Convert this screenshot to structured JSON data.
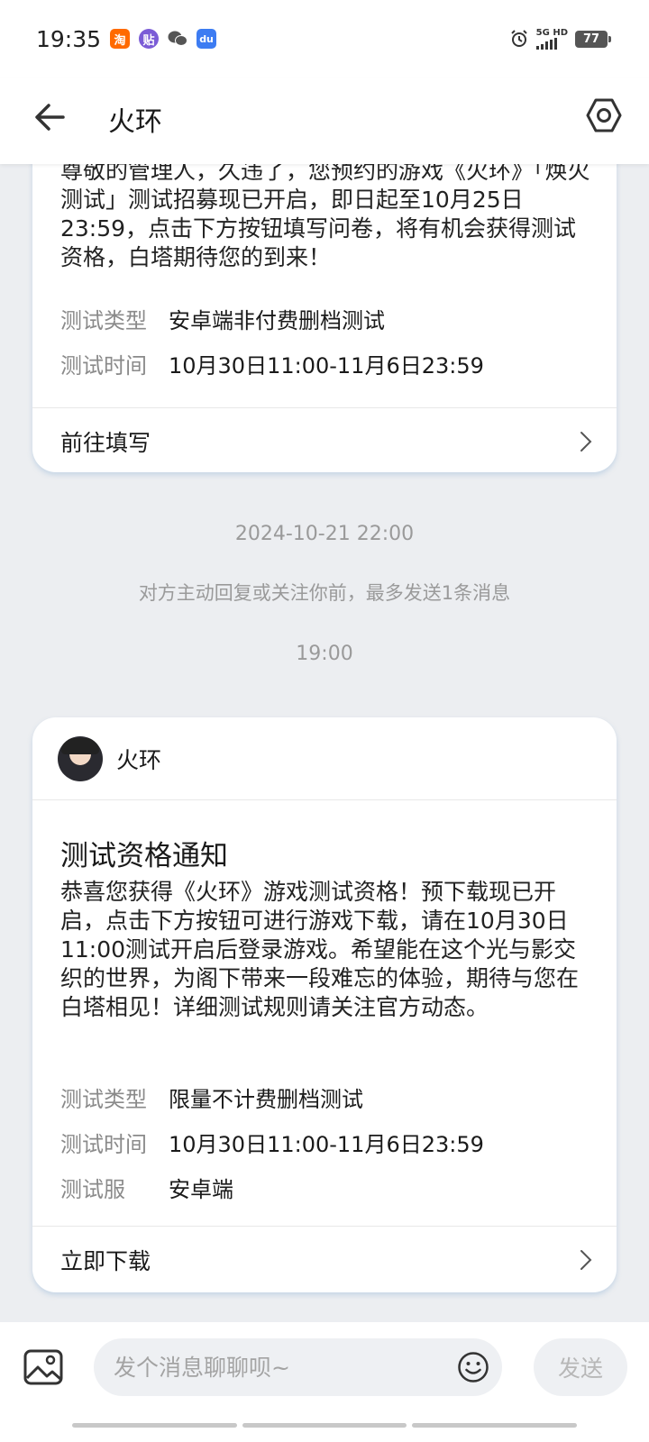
{
  "status_bar": {
    "time": "19:35",
    "notifications": [
      {
        "icon": "taobao-icon",
        "glyph": "淘",
        "color": "#ff6a00"
      },
      {
        "icon": "tieba-icon",
        "glyph": "贴",
        "color": "#7b5cd6"
      },
      {
        "icon": "wechat-icon",
        "glyph": "",
        "color": "#555555"
      },
      {
        "icon": "baidu-icon",
        "glyph": "du",
        "color": "#3d7cf2"
      }
    ],
    "network": "5G HD",
    "battery": "77"
  },
  "header": {
    "title": "火环"
  },
  "messages": [
    {
      "body": "尊敬的管理人，久违了，您预约的游戏《火环》「焕火测试」测试招募现已开启，即日起至10月25日23:59，点击下方按钮填写问卷，将有机会获得测试资格，白塔期待您的到来！",
      "fields": [
        {
          "label": "测试类型",
          "value": "安卓端非付费删档测试"
        },
        {
          "label": "测试时间",
          "value": "10月30日11:00-11月6日23:59"
        }
      ],
      "action": "前往填写"
    },
    {
      "sender": "火环",
      "title": "测试资格通知",
      "body": "恭喜您获得《火环》游戏测试资格！预下载现已开启，点击下方按钮可进行游戏下载，请在10月30日11:00测试开启后登录游戏。希望能在这个光与影交织的世界，为阁下带来一段难忘的体验，期待与您在白塔相见！详细测试规则请关注官方动态。",
      "fields": [
        {
          "label": "测试类型",
          "value": "限量不计费删档测试"
        },
        {
          "label": "测试时间",
          "value": "10月30日11:00-11月6日23:59"
        },
        {
          "label": "测试服",
          "value": "安卓端"
        }
      ],
      "action": "立即下载"
    }
  ],
  "timestamps": {
    "first": "2024-10-21 22:00",
    "second": "19:00"
  },
  "system_note": "对方主动回复或关注你前，最多发送1条消息",
  "input": {
    "placeholder": "发个消息聊聊呗~",
    "send_label": "发送"
  },
  "colors": {
    "background": "#eceef1",
    "card": "#ffffff",
    "muted_text": "#9a9a9a"
  }
}
